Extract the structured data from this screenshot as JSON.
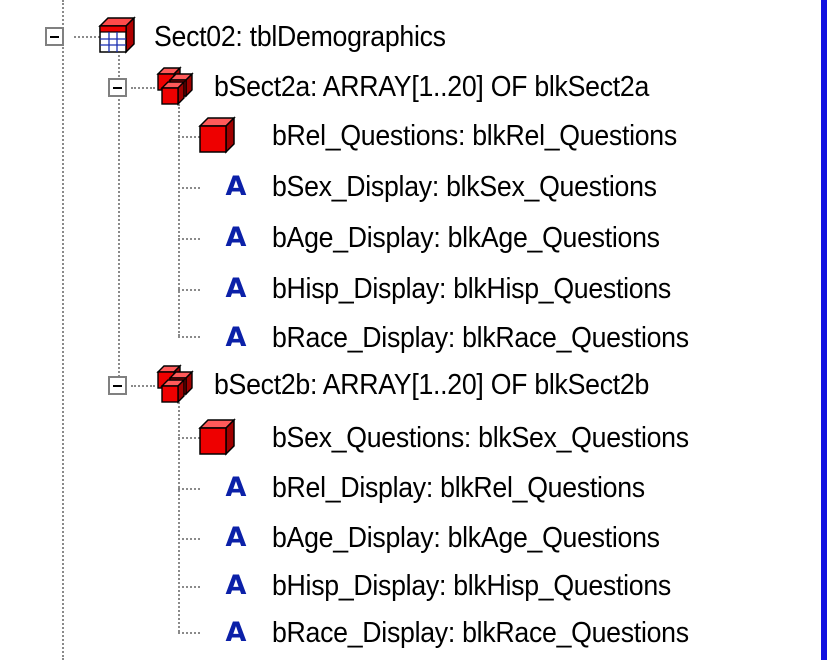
{
  "tree": {
    "root": {
      "label": "Sect02: tblDemographics",
      "icon": "table-icon",
      "expanded": true
    },
    "arrays": [
      {
        "label": "bSect2a: ARRAY[1..20] OF blkSect2a",
        "icon": "block-array-icon",
        "expanded": true,
        "children": [
          {
            "label": "bRel_Questions: blkRel_Questions",
            "icon": "block-icon"
          },
          {
            "label": "bSex_Display: blkSex_Questions",
            "icon": "field-icon",
            "glyph": "A"
          },
          {
            "label": "bAge_Display: blkAge_Questions",
            "icon": "field-icon",
            "glyph": "A"
          },
          {
            "label": "bHisp_Display: blkHisp_Questions",
            "icon": "field-icon",
            "glyph": "A"
          },
          {
            "label": "bRace_Display: blkRace_Questions",
            "icon": "field-icon",
            "glyph": "A"
          }
        ]
      },
      {
        "label": "bSect2b: ARRAY[1..20] OF blkSect2b",
        "icon": "block-array-icon",
        "expanded": true,
        "children": [
          {
            "label": "bSex_Questions: blkSex_Questions",
            "icon": "block-icon"
          },
          {
            "label": "bRel_Display: blkRel_Questions",
            "icon": "field-icon",
            "glyph": "A"
          },
          {
            "label": "bAge_Display: blkAge_Questions",
            "icon": "field-icon",
            "glyph": "A"
          },
          {
            "label": "bHisp_Display: blkHisp_Questions",
            "icon": "field-icon",
            "glyph": "A"
          },
          {
            "label": "bRace_Display: blkRace_Questions",
            "icon": "field-icon",
            "glyph": "A"
          }
        ]
      }
    ]
  },
  "colors": {
    "window_background": "#1010e0",
    "tree_background": "#ffffff",
    "block_red": "#ee0000",
    "field_glyph_blue": "#0b20a8"
  }
}
